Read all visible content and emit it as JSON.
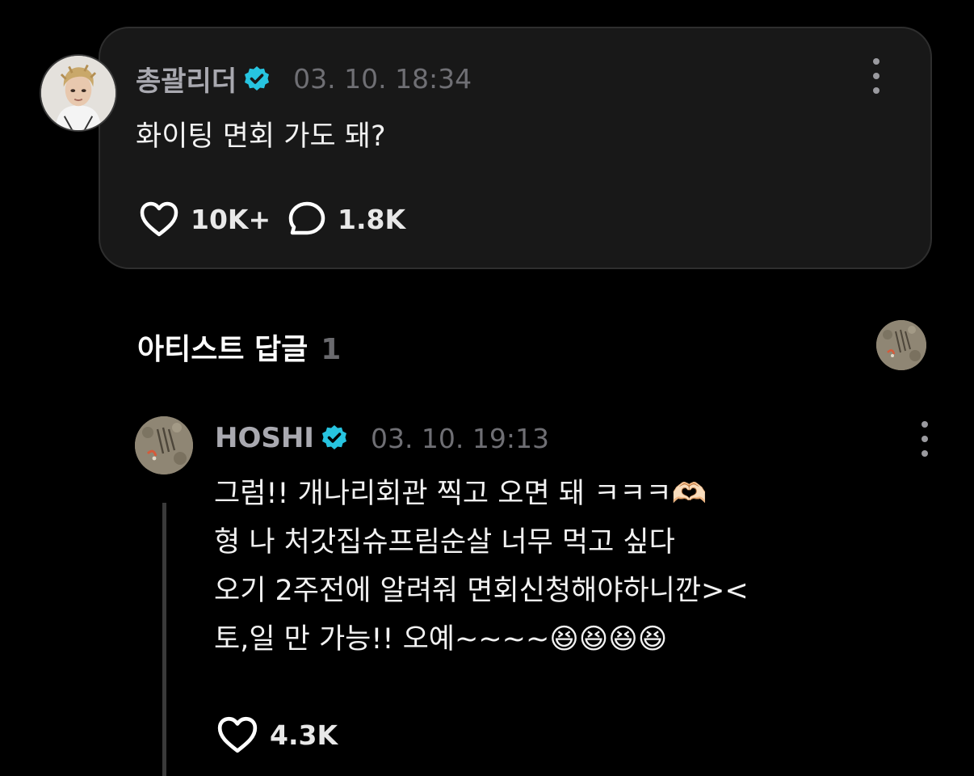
{
  "post": {
    "author": "총괄리더",
    "timestamp": "03. 10. 18:34",
    "text": "화이팅 면회 가도 돼?",
    "likes": "10K+",
    "comments": "1.8K"
  },
  "section": {
    "title": "아티스트 답글",
    "count": "1"
  },
  "reply": {
    "author": "HOSHI",
    "timestamp": "03. 10. 19:13",
    "lines": [
      "그럼!! 개나리회관 찍고 오면 돼 ㅋㅋㅋ🫶🏻",
      "형 나 처갓집슈프림순살 너무 먹고 싶다",
      "오기 2주전에 알려줘 면회신청해야하니깐><",
      "토,일 만 가능!! 오예~~~~😆😆😆😆"
    ],
    "likes": "4.3K"
  },
  "colors": {
    "background": "#000000",
    "card": "#181818",
    "verified": "#27c4e0",
    "author": "#a9a9b0",
    "timestamp": "#6f6f74"
  },
  "icons": [
    "verified-badge-icon",
    "heart-icon",
    "comment-bubble-icon",
    "more-vertical-icon"
  ]
}
